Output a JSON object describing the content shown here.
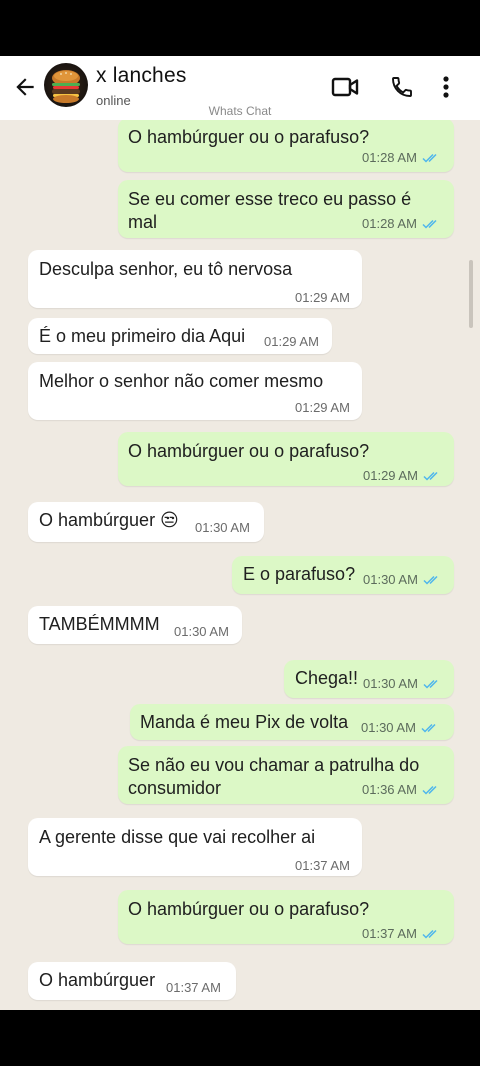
{
  "header": {
    "contact_name": "x lanches",
    "contact_status": "online",
    "watermark": "Whats Chat"
  },
  "colors": {
    "outgoing_bubble": "#dcf8c6",
    "incoming_bubble": "#ffffff",
    "chat_background": "#efeae2",
    "read_ticks": "#4fb6ec"
  },
  "icons": {
    "back": "arrow-left-icon",
    "video": "video-call-icon",
    "call": "phone-icon",
    "menu": "more-vertical-icon"
  },
  "messages": [
    {
      "dir": "out",
      "lines": [
        "O hambúrguer ou o parafuso?"
      ],
      "time": "01:28 AM",
      "read": true
    },
    {
      "dir": "out",
      "lines": [
        "Se eu comer esse treco eu passo é",
        "mal"
      ],
      "time": "01:28 AM",
      "read": true
    },
    {
      "dir": "in",
      "lines": [
        "Desculpa senhor, eu tô nervosa"
      ],
      "time": "01:29 AM"
    },
    {
      "dir": "in",
      "lines": [
        "É o meu primeiro dia Aqui"
      ],
      "time": "01:29 AM"
    },
    {
      "dir": "in",
      "lines": [
        "Melhor o senhor não comer mesmo"
      ],
      "time": "01:29 AM"
    },
    {
      "dir": "out",
      "lines": [
        "O hambúrguer ou o parafuso?"
      ],
      "time": "01:29 AM",
      "read": true
    },
    {
      "dir": "in",
      "lines": [
        "O hambúrguer 😒"
      ],
      "time": "01:30 AM"
    },
    {
      "dir": "out",
      "lines": [
        "E o parafuso?"
      ],
      "time": "01:30 AM",
      "read": true
    },
    {
      "dir": "in",
      "lines": [
        "TAMBÉMMMM"
      ],
      "time": "01:30 AM"
    },
    {
      "dir": "out",
      "lines": [
        "Chega!!"
      ],
      "time": "01:30 AM",
      "read": true
    },
    {
      "dir": "out",
      "lines": [
        "Manda é meu Pix de volta"
      ],
      "time": "01:30 AM",
      "read": true
    },
    {
      "dir": "out",
      "lines": [
        "Se não eu vou chamar a patrulha do",
        "consumidor"
      ],
      "time": "01:36 AM",
      "read": true
    },
    {
      "dir": "in",
      "lines": [
        "A gerente disse que vai recolher ai"
      ],
      "time": "01:37 AM"
    },
    {
      "dir": "out",
      "lines": [
        "O hambúrguer ou o parafuso?"
      ],
      "time": "01:37 AM",
      "read": true
    },
    {
      "dir": "in",
      "lines": [
        "O hambúrguer"
      ],
      "time": "01:37 AM"
    }
  ]
}
